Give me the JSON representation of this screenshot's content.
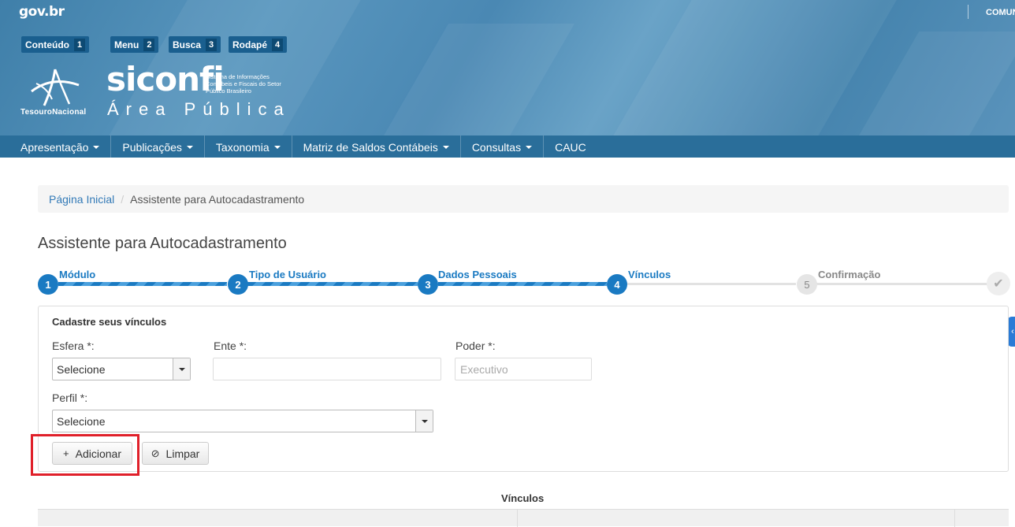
{
  "gov": {
    "logo": "gov.br",
    "right_link": "COMUNICA"
  },
  "skip_links": [
    {
      "label": "Conteúdo",
      "key": "1"
    },
    {
      "label": "Menu",
      "key": "2"
    },
    {
      "label": "Busca",
      "key": "3"
    },
    {
      "label": "Rodapé",
      "key": "4"
    }
  ],
  "brand": {
    "org": "TesouroNacional",
    "name": "siconfi",
    "subtitle": "Sistema de Informações Contábeis e Fiscais do Setor Público Brasileiro",
    "area": "Área Pública"
  },
  "nav": [
    {
      "label": "Apresentação",
      "dropdown": true
    },
    {
      "label": "Publicações",
      "dropdown": true
    },
    {
      "label": "Taxonomia",
      "dropdown": true
    },
    {
      "label": "Matriz de Saldos Contábeis",
      "dropdown": true
    },
    {
      "label": "Consultas",
      "dropdown": true
    },
    {
      "label": "CAUC",
      "dropdown": false
    }
  ],
  "breadcrumb": {
    "home": "Página Inicial",
    "separator": "/",
    "current": "Assistente para Autocadastramento"
  },
  "page_title": "Assistente para Autocadastramento",
  "wizard": {
    "steps": [
      {
        "num": "1",
        "label": "Módulo",
        "state": "done"
      },
      {
        "num": "2",
        "label": "Tipo de Usuário",
        "state": "done"
      },
      {
        "num": "3",
        "label": "Dados Pessoais",
        "state": "done"
      },
      {
        "num": "4",
        "label": "Vínculos",
        "state": "current"
      },
      {
        "num": "5",
        "label": "Confirmação",
        "state": "todo"
      }
    ],
    "final_icon": "check-icon"
  },
  "form": {
    "title": "Cadastre seus vínculos",
    "esfera_label": "Esfera *:",
    "esfera_value": "Selecione",
    "ente_label": "Ente *:",
    "ente_value": "",
    "poder_label": "Poder *:",
    "poder_placeholder": "Executivo",
    "perfil_label": "Perfil *:",
    "perfil_value": "Selecione",
    "add_button": "Adicionar",
    "clear_button": "Limpar"
  },
  "vinculos": {
    "title": "Vínculos"
  },
  "colors": {
    "primary": "#1a7ac2",
    "nav": "#2a6e9a",
    "highlight": "#e0202a"
  }
}
